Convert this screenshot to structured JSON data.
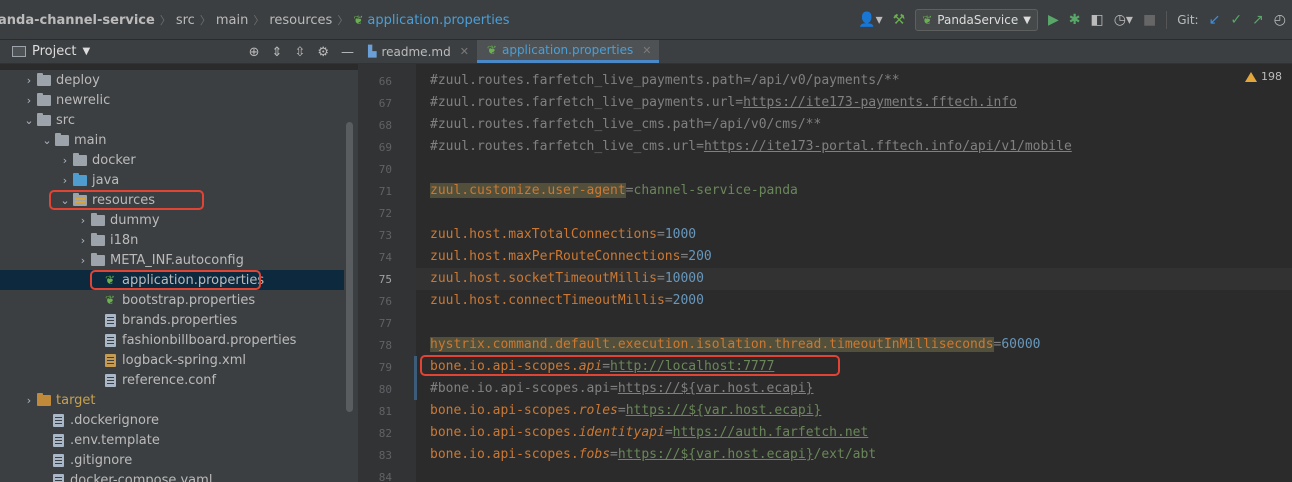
{
  "breadcrumb": {
    "items": [
      "anda-channel-service",
      "src",
      "main",
      "resources",
      "application.properties"
    ]
  },
  "toolbar": {
    "run_config": "PandaService",
    "git_label": "Git:",
    "icons": [
      "user-icon",
      "hammer-icon",
      "run-icon",
      "debug-icon",
      "coverage-icon",
      "profile-icon",
      "stop-icon",
      "git-update-icon",
      "git-commit-icon",
      "git-push-icon",
      "history-icon"
    ]
  },
  "project_panel": {
    "title": "Project"
  },
  "tree": [
    {
      "label": "deploy",
      "arrow": "›",
      "type": "folder"
    },
    {
      "label": "newrelic",
      "arrow": "›",
      "type": "folder"
    },
    {
      "label": "src",
      "arrow": "⌄",
      "type": "folder"
    },
    {
      "label": "main",
      "arrow": "⌄",
      "type": "folder"
    },
    {
      "label": "docker",
      "arrow": "›",
      "type": "folder"
    },
    {
      "label": "java",
      "arrow": "›",
      "type": "folder-blue"
    },
    {
      "label": "resources",
      "arrow": "⌄",
      "type": "folder-res"
    },
    {
      "label": "dummy",
      "arrow": "›",
      "type": "folder"
    },
    {
      "label": "i18n",
      "arrow": "›",
      "type": "folder"
    },
    {
      "label": "META_INF.autoconfig",
      "arrow": "›",
      "type": "folder"
    },
    {
      "label": "application.properties",
      "arrow": "",
      "type": "spring"
    },
    {
      "label": "bootstrap.properties",
      "arrow": "",
      "type": "spring"
    },
    {
      "label": "brands.properties",
      "arrow": "",
      "type": "file"
    },
    {
      "label": "fashionbillboard.properties",
      "arrow": "",
      "type": "file"
    },
    {
      "label": "logback-spring.xml",
      "arrow": "",
      "type": "xml"
    },
    {
      "label": "reference.conf",
      "arrow": "",
      "type": "file"
    },
    {
      "label": "target",
      "arrow": "›",
      "type": "folder-orange"
    },
    {
      "label": ".dockerignore",
      "arrow": "",
      "type": "file"
    },
    {
      "label": ".env.template",
      "arrow": "",
      "type": "file"
    },
    {
      "label": ".gitignore",
      "arrow": "",
      "type": "file"
    },
    {
      "label": "docker-compose.yaml",
      "arrow": "",
      "type": "file"
    }
  ],
  "tabs": [
    {
      "label": "readme.md"
    },
    {
      "label": "application.properties"
    }
  ],
  "editor": {
    "warning_count": "198",
    "lines": [
      {
        "n": "66",
        "parts": [
          {
            "t": "#zuul.routes.farfetch_live_payments.path=/api/v0/payments/**",
            "c": "comment"
          }
        ]
      },
      {
        "n": "67",
        "parts": [
          {
            "t": "#zuul.routes.farfetch_live_payments.url=",
            "c": "comment"
          },
          {
            "t": "https://ite173-payments.fftech.info",
            "c": "url-grey"
          }
        ]
      },
      {
        "n": "68",
        "parts": [
          {
            "t": "#zuul.routes.farfetch_live_cms.path=/api/v0/cms/**",
            "c": "comment"
          }
        ]
      },
      {
        "n": "69",
        "parts": [
          {
            "t": "#zuul.routes.farfetch_live_cms.url=",
            "c": "comment"
          },
          {
            "t": "https://ite173-portal.fftech.info/api/v1/mobile",
            "c": "url-grey"
          }
        ]
      },
      {
        "n": "70",
        "parts": []
      },
      {
        "n": "71",
        "parts": [
          {
            "t": "zuul.customize.user-agent",
            "c": "keyhl"
          },
          {
            "t": "=",
            "c": "eq"
          },
          {
            "t": "channel-service-panda",
            "c": "val"
          }
        ]
      },
      {
        "n": "72",
        "parts": []
      },
      {
        "n": "73",
        "parts": [
          {
            "t": "zuul.host.maxTotalConnections",
            "c": "key"
          },
          {
            "t": "=",
            "c": "eq"
          },
          {
            "t": "1000",
            "c": "num"
          }
        ]
      },
      {
        "n": "74",
        "parts": [
          {
            "t": "zuul.host.maxPerRouteConnections",
            "c": "key"
          },
          {
            "t": "=",
            "c": "eq"
          },
          {
            "t": "200",
            "c": "num"
          }
        ]
      },
      {
        "n": "75",
        "parts": [
          {
            "t": "zuul.host.socketTimeoutMillis",
            "c": "key"
          },
          {
            "t": "=",
            "c": "eq"
          },
          {
            "t": "10000",
            "c": "num"
          }
        ]
      },
      {
        "n": "76",
        "parts": [
          {
            "t": "zuul.host.connectTimeoutMillis",
            "c": "key"
          },
          {
            "t": "=",
            "c": "eq"
          },
          {
            "t": "2000",
            "c": "num"
          }
        ]
      },
      {
        "n": "77",
        "parts": []
      },
      {
        "n": "78",
        "parts": [
          {
            "t": "hystrix.command.default.execution.isolation.thread.timeoutInMilliseconds",
            "c": "keyhl"
          },
          {
            "t": "=",
            "c": "eq"
          },
          {
            "t": "60000",
            "c": "num"
          }
        ]
      },
      {
        "n": "79",
        "parts": [
          {
            "t": "bone.io.api-scopes.",
            "c": "key"
          },
          {
            "t": "api",
            "c": "key-ital"
          },
          {
            "t": "=",
            "c": "eq"
          },
          {
            "t": "http://localhost:7777",
            "c": "url-green"
          }
        ]
      },
      {
        "n": "80",
        "parts": [
          {
            "t": "#bone.io.api-scopes.api=",
            "c": "comment"
          },
          {
            "t": "https://${var.host.ecapi}",
            "c": "url-grey"
          }
        ]
      },
      {
        "n": "81",
        "parts": [
          {
            "t": "bone.io.api-scopes.",
            "c": "key"
          },
          {
            "t": "roles",
            "c": "key-ital"
          },
          {
            "t": "=",
            "c": "eq"
          },
          {
            "t": "https://${var.host.ecapi}",
            "c": "url-green"
          }
        ]
      },
      {
        "n": "82",
        "parts": [
          {
            "t": "bone.io.api-scopes.",
            "c": "key"
          },
          {
            "t": "identityapi",
            "c": "key-ital"
          },
          {
            "t": "=",
            "c": "eq"
          },
          {
            "t": "https://auth.farfetch.net",
            "c": "url-green"
          }
        ]
      },
      {
        "n": "83",
        "parts": [
          {
            "t": "bone.io.api-scopes.",
            "c": "key"
          },
          {
            "t": "fobs",
            "c": "key-ital"
          },
          {
            "t": "=",
            "c": "eq"
          },
          {
            "t": "https://${var.host.ecapi}",
            "c": "url-green"
          },
          {
            "t": "/ext/abt",
            "c": "val"
          }
        ]
      },
      {
        "n": "84",
        "parts": []
      }
    ]
  }
}
